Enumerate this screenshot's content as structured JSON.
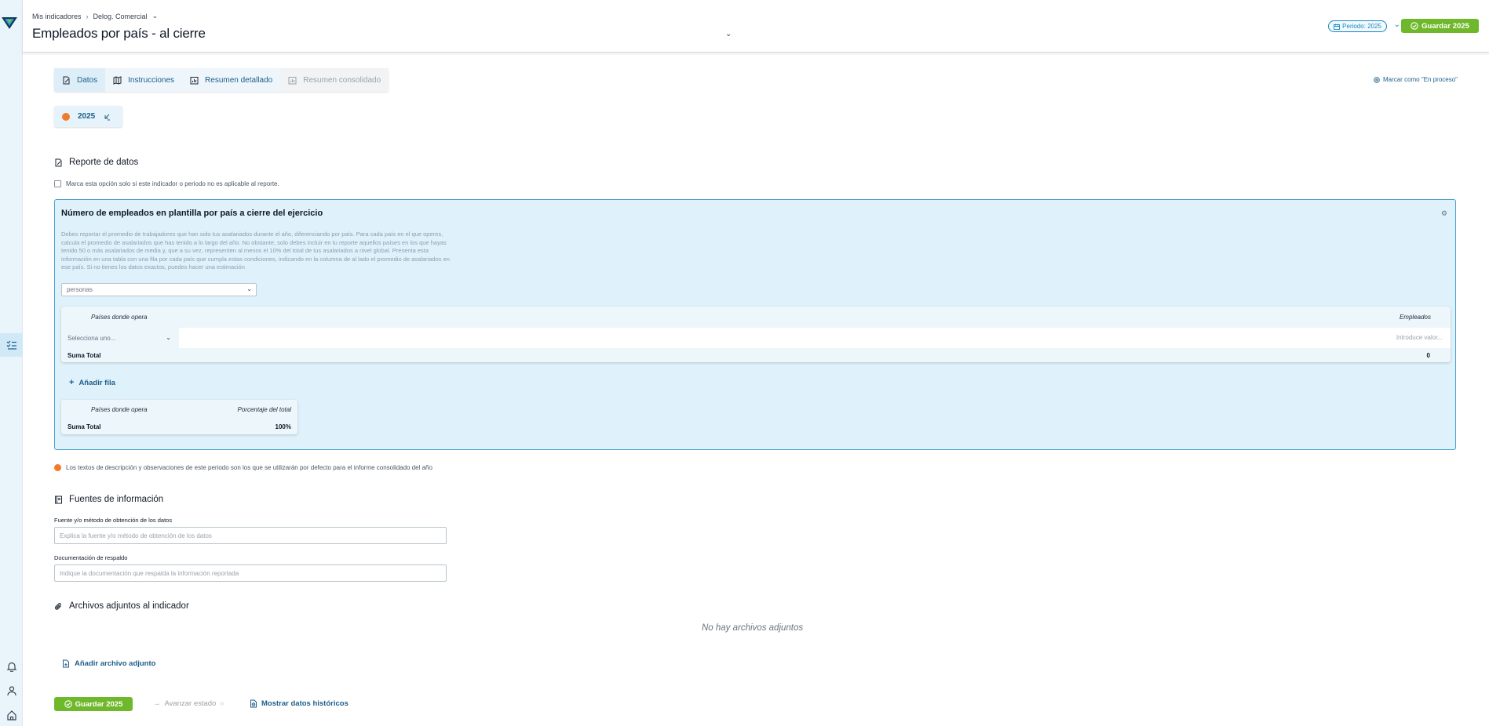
{
  "breadcrumb": {
    "root": "Mis indicadores",
    "current": "Delog. Comercial"
  },
  "header": {
    "title": "Empleados por país - al cierre",
    "period_label": "Periodo: 2025",
    "save_label": "Guardar 2025"
  },
  "tabs": [
    {
      "label": "Datos"
    },
    {
      "label": "Instrucciones"
    },
    {
      "label": "Resumen detallado"
    },
    {
      "label": "Resumen consolidado"
    }
  ],
  "mark_in_process": "Marcar como \"En proceso\"",
  "year_chip": {
    "label": "2025"
  },
  "report": {
    "title": "Reporte de datos",
    "not_applicable_label": "Marca esta opción solo si este indicador o periodo no es aplicable al reporte."
  },
  "panel": {
    "title": "Número de empleados en plantilla por país a cierre del ejercicio",
    "description": "Debes reportar el promedio de trabajadores que han sido tus asalariados durante el año, diferenciando por país. Para cada país en el que operes, calcula el promedio de asalariados que has tenido a lo largo del año. No obstante, solo debes incluir en tu reporte aquellos países en los que hayas tenido 50 o más asalariados de media y, que a su vez, representen al menos el 10% del total de tus asalariados a nivel global. Presenta esta información en una tabla con una fila por cada país que cumpla estas condiciones, indicando en la columna de al lado el promedio de asalariados en ese país. Si no tienes los datos exactos, puedes hacer una estimación",
    "unit_value": "personas",
    "table1": {
      "col_country": "Países donde opera",
      "col_employees": "Empleados",
      "country_placeholder": "Selecciona uno...",
      "value_placeholder": "Introduce valor...",
      "total_label": "Suma Total",
      "total_value": "0"
    },
    "add_row_label": "Añadir fila",
    "table2": {
      "col_country": "Países donde opera",
      "col_percent": "Porcentaje del total",
      "total_label": "Suma Total",
      "total_value": "100%"
    }
  },
  "note": "Los textos de descripción y observaciones de este periodo son los que se utilizarán por defecto para el informe consolidado del año",
  "sources": {
    "title": "Fuentes de información",
    "field1_label": "Fuente y/o método de obtención de los datos",
    "field1_placeholder": "Explica la fuente y/o método de obtención de los datos",
    "field2_label": "Documentación de respaldo",
    "field2_placeholder": "Indique la documentación que respalda la información reportada"
  },
  "attachments": {
    "title": "Archivos adjuntos al indicador",
    "empty_label": "No hay archivos adjuntos",
    "add_label": "Añadir archivo adjunto"
  },
  "footer": {
    "save_label": "Guardar 2025",
    "advance_label": "Avanzar estado",
    "history_label": "Mostrar datos históricos"
  },
  "colors": {
    "accent": "#1786c5",
    "save_green": "#6fb82b",
    "panel_bg": "#dff1fa",
    "warning": "#f07c2b"
  }
}
